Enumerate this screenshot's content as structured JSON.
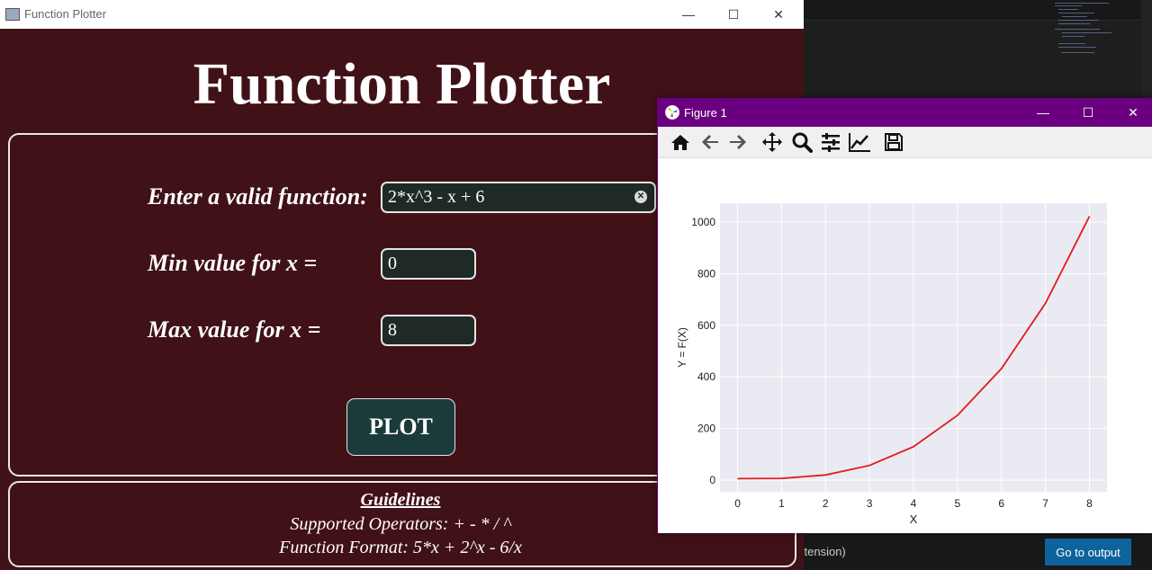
{
  "ide": {
    "status_text": "xtension)",
    "goto_button": "Go to output"
  },
  "plotter": {
    "window_title": "Function Plotter",
    "heading": "Function Plotter",
    "function_label": "Enter a valid function:",
    "function_value": "2*x^3 - x + 6",
    "min_label": "Min value for x =",
    "min_value": "0",
    "max_label": "Max value for x =",
    "max_value": "8",
    "plot_button": "PLOT",
    "guidelines_title": "Guidelines",
    "operators_text": "Supported Operators: + - * / ^",
    "format_text": "Function Format: 5*x + 2^x - 6/x"
  },
  "figure": {
    "window_title": "Figure 1",
    "toolbar": [
      "home-icon",
      "back-icon",
      "forward-icon",
      "pan-icon",
      "zoom-icon",
      "configure-subplots-icon",
      "edit-axis-icon",
      "save-icon"
    ]
  },
  "chart_data": {
    "type": "line",
    "xlabel": "X",
    "ylabel": "Y = F(X)",
    "x": [
      0,
      1,
      2,
      3,
      4,
      5,
      6,
      7,
      8
    ],
    "series": [
      {
        "values": [
          6,
          7,
          20,
          57,
          130,
          251,
          432,
          685,
          1022
        ],
        "color": "#e31a1c"
      }
    ],
    "xlim": [
      -0.4,
      8.4
    ],
    "ylim": [
      -45,
      1073
    ],
    "xticks": [
      0,
      1,
      2,
      3,
      4,
      5,
      6,
      7,
      8
    ],
    "yticks": [
      0,
      200,
      400,
      600,
      800,
      1000
    ],
    "grid": true,
    "background": "#eaeaf2"
  }
}
